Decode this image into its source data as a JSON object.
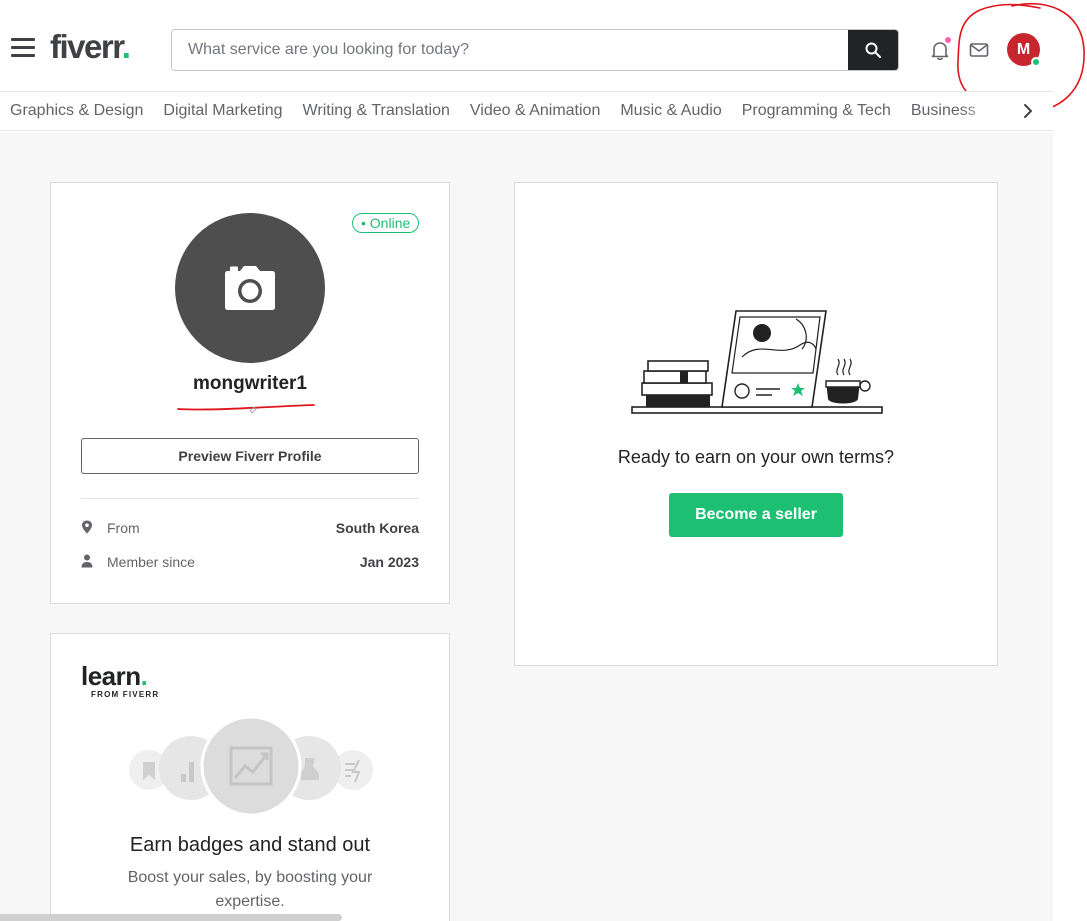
{
  "header": {
    "logo_text": "fiverr",
    "logo_dot": ".",
    "search_placeholder": "What service are you looking for today?",
    "avatar_initial": "M"
  },
  "categories": [
    "Graphics & Design",
    "Digital Marketing",
    "Writing & Translation",
    "Video & Animation",
    "Music & Audio",
    "Programming & Tech",
    "Business"
  ],
  "profile": {
    "online_label": "• Online",
    "username": "mongwriter1",
    "preview_button": "Preview Fiverr Profile",
    "from_label": "From",
    "from_value": "South Korea",
    "member_label": "Member since",
    "member_value": "Jan 2023"
  },
  "learn": {
    "logo_word": "learn",
    "logo_dot": ".",
    "logo_sub": "FROM FIVERR",
    "title": "Earn badges and stand out",
    "description": "Boost your sales, by boosting your expertise."
  },
  "seller": {
    "title": "Ready to earn on your own terms?",
    "button": "Become a seller"
  },
  "colors": {
    "brand_green": "#1dbf73",
    "avatar_red": "#c6262e",
    "notification_pink": "#ff62ad",
    "annotation_red": "#e0141c"
  }
}
